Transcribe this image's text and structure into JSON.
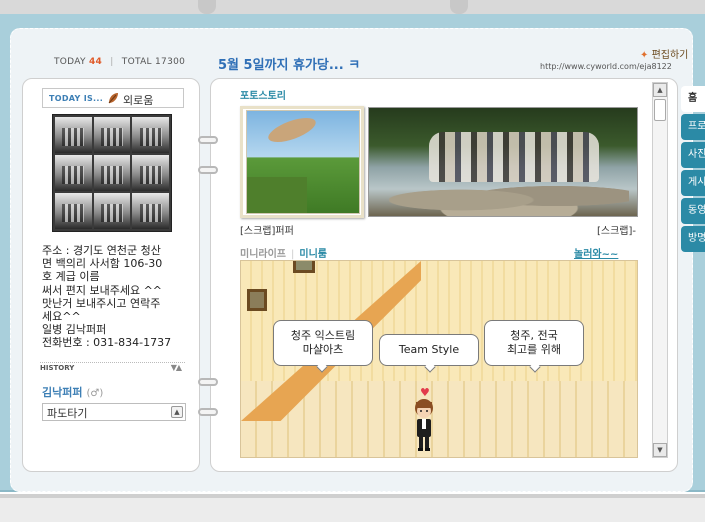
{
  "counter": {
    "today_label": "TODAY",
    "today_value": "44",
    "separator": "|",
    "total_label": "TOTAL",
    "total_value": "17300"
  },
  "profile": {
    "today_is_label": "TODAY IS...",
    "mood": "외로움",
    "intro": "주소 : 경기도 연천군 청산\n면 백의리 사서함 106-30\n호 계급 이름\n써서 편지 보내주세요 ^^\n맛난거 보내주시고 연락주\n세요^^\n일병 김낙퍼퍼\n전화번호 : 031-834-1737",
    "history_label": "HISTORY",
    "history_arrows": "▼▲",
    "owner_name": "김낙퍼퍼",
    "owner_gender": "(♂)",
    "select_value": "파도타기",
    "select_arrow": "▲"
  },
  "header": {
    "title": "5월 5일까지 휴가당... ㅋ",
    "edit_star": "✦",
    "edit_label": "편집하기",
    "url": "http://www.cyworld.com/eja8122"
  },
  "photos": {
    "section_title": "포토스토리",
    "scrap_left": "[스크랩]퍼퍼",
    "scrap_right": "[스크랩]-"
  },
  "miniroom": {
    "tab_minilife": "미니라이프",
    "tab_divider": "|",
    "tab_miniroom": "미니룸",
    "visit_link": "놀러와~~",
    "bubble1": "청주 익스트림\n마샬아츠",
    "bubble2": "Team Style",
    "bubble3": "청주, 전국\n최고를 위해",
    "heart": "♥"
  },
  "scrollbar": {
    "up": "▲",
    "down": "▼"
  },
  "tabs": [
    "홈",
    "프로필",
    "사진첩",
    "게시판",
    "동영상",
    "방명록"
  ],
  "colors": {
    "frame": "#a9cfdb",
    "accent": "#2b8aa6",
    "title": "#2f6fb6",
    "today_num": "#e05a28"
  }
}
